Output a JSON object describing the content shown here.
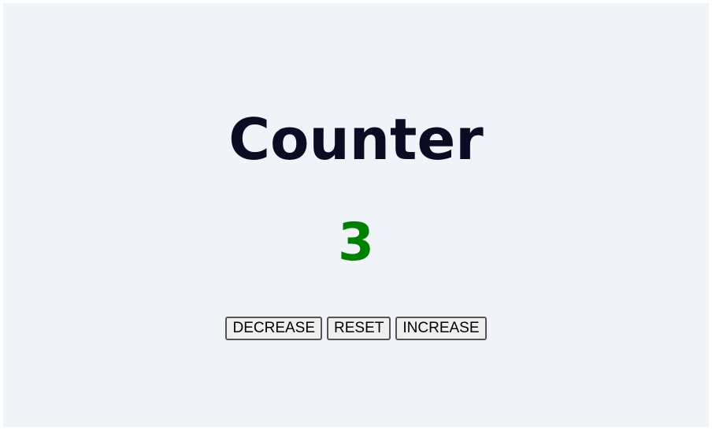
{
  "counter": {
    "title": "Counter",
    "value": "3",
    "value_color": "#008000"
  },
  "controls": {
    "decrease_label": "DECREASE",
    "reset_label": "RESET",
    "increase_label": "INCREASE"
  },
  "colors": {
    "background": "#f0f4f8",
    "title": "#0a0c24"
  }
}
